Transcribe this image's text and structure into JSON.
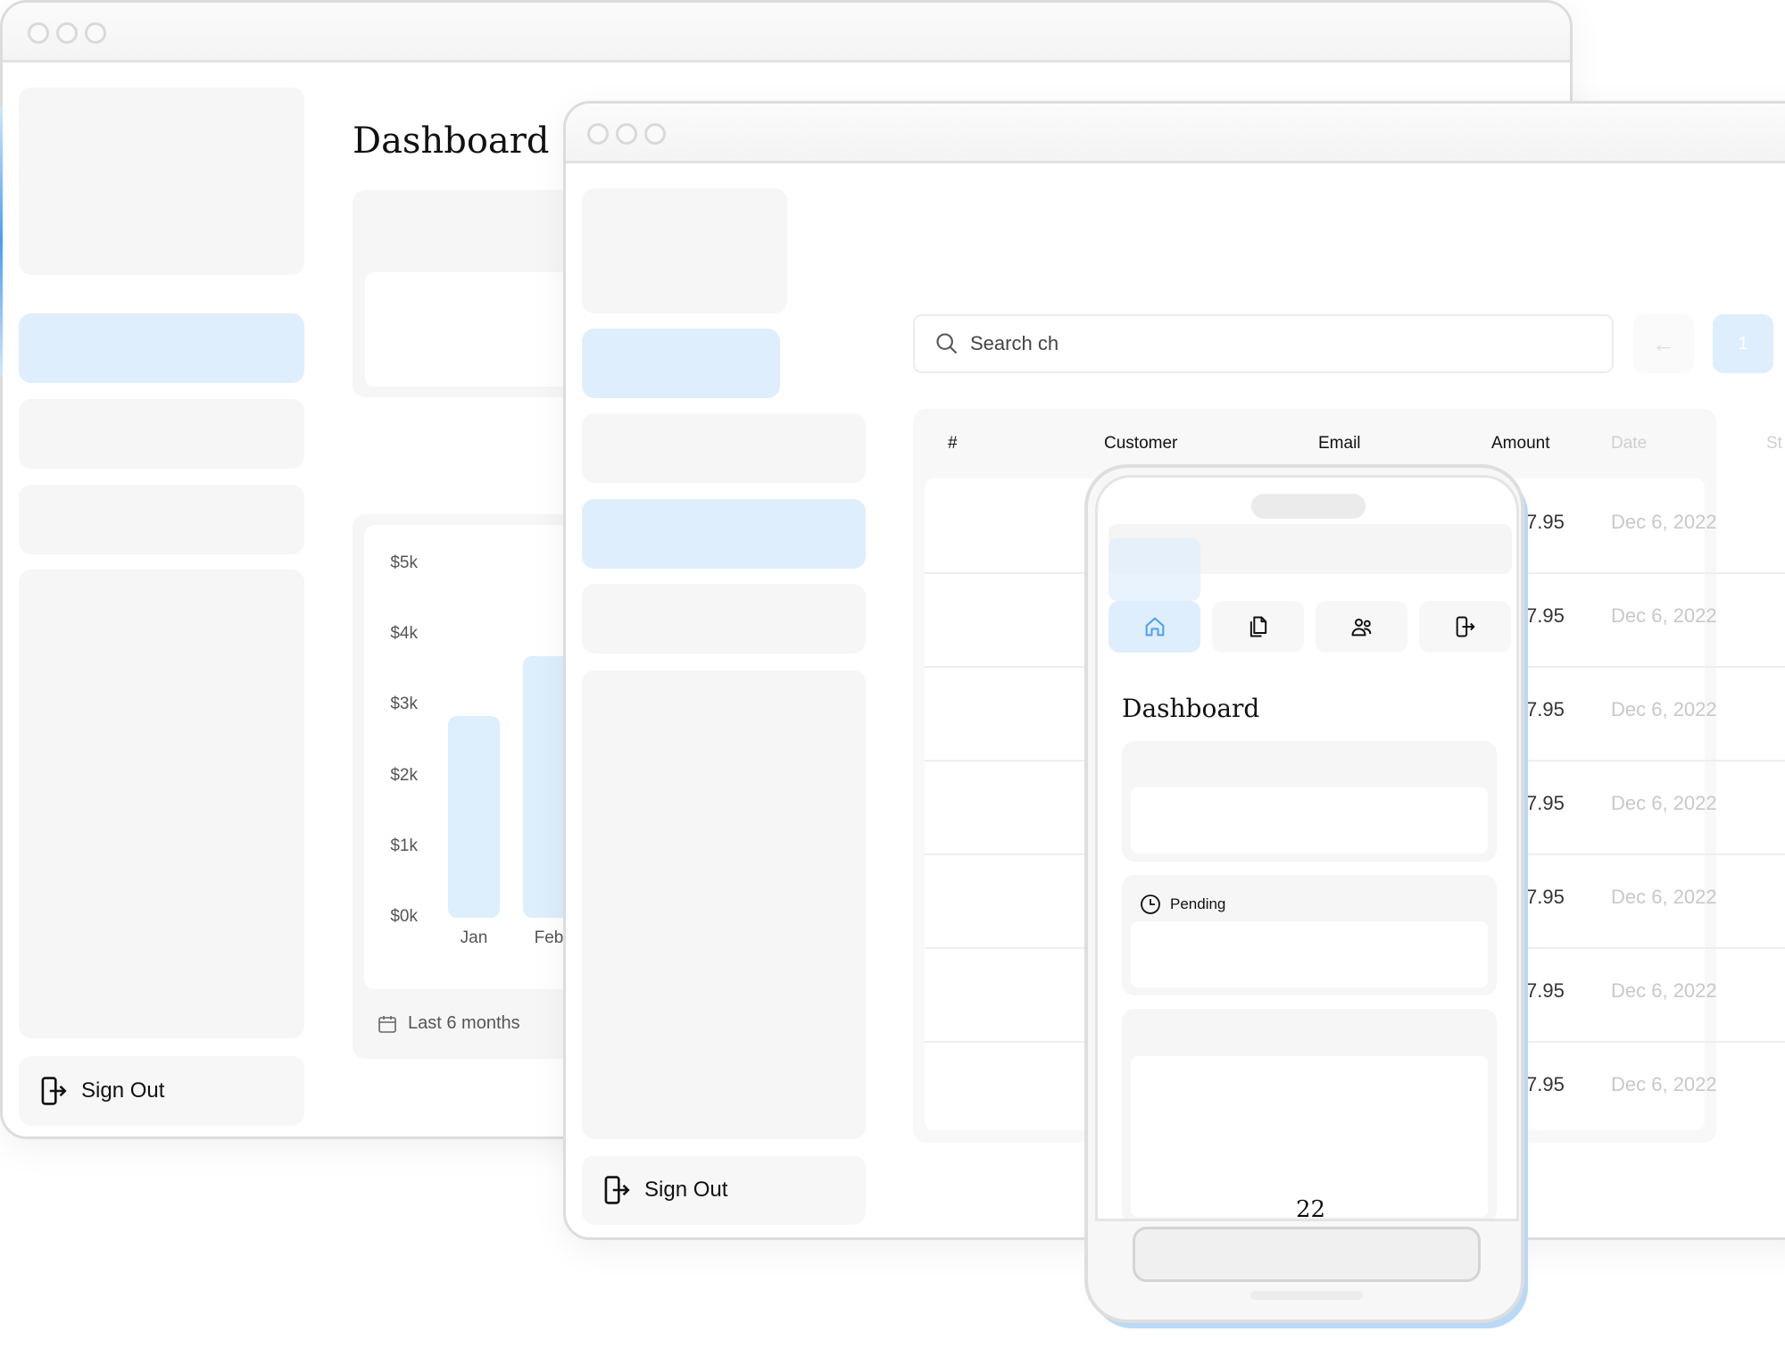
{
  "back_window": {
    "title": "Dashboard",
    "sign_out_label": "Sign Out",
    "chart_footer": "Last 6 months"
  },
  "front_window": {
    "search": {
      "value": "Search ch",
      "placeholder": "Search"
    },
    "pagination": {
      "prev_icon": "arrow-left-icon",
      "current_page": "1"
    },
    "table": {
      "columns": [
        "#",
        "Customer",
        "Email",
        "Amount",
        "Date",
        "St"
      ],
      "rows": [
        {
          "id": "",
          "amount": "7.95",
          "date": "Dec 6, 2022"
        },
        {
          "id": "...",
          "amount": "7.95",
          "date": "Dec 6, 2022"
        },
        {
          "id": "...",
          "amount": "7.95",
          "date": "Dec 6, 2022"
        },
        {
          "id": ".",
          "amount": "7.95",
          "date": "Dec 6, 2022"
        },
        {
          "id": ".",
          "amount": "7.95",
          "date": "Dec 6, 2022"
        },
        {
          "id": ".",
          "amount": "7.95",
          "date": "Dec 6, 2022"
        },
        {
          "id": "...",
          "amount": "7.95",
          "date": "Dec 6, 2022"
        }
      ]
    },
    "sign_out_label": "Sign Out"
  },
  "phone": {
    "nav": [
      {
        "icon": "home-icon",
        "active": true
      },
      {
        "icon": "documents-icon",
        "active": false
      },
      {
        "icon": "users-icon",
        "active": false
      },
      {
        "icon": "sign-out-icon",
        "active": false
      }
    ],
    "title": "Dashboard",
    "pending_label": "Pending",
    "partial_value": "22"
  },
  "colors": {
    "accent": "#4b9cf5",
    "accent_light": "#deeefc"
  },
  "chart_data": {
    "type": "bar",
    "title": "",
    "categories": [
      "Jan",
      "Feb"
    ],
    "values": [
      2850,
      3700
    ],
    "yticks": [
      "$0k",
      "$1k",
      "$2k",
      "$3k",
      "$4k",
      "$5k"
    ],
    "ylim": [
      0,
      5000
    ],
    "xlabel": "",
    "ylabel": "",
    "grid": false,
    "footer": "Last 6 months"
  }
}
